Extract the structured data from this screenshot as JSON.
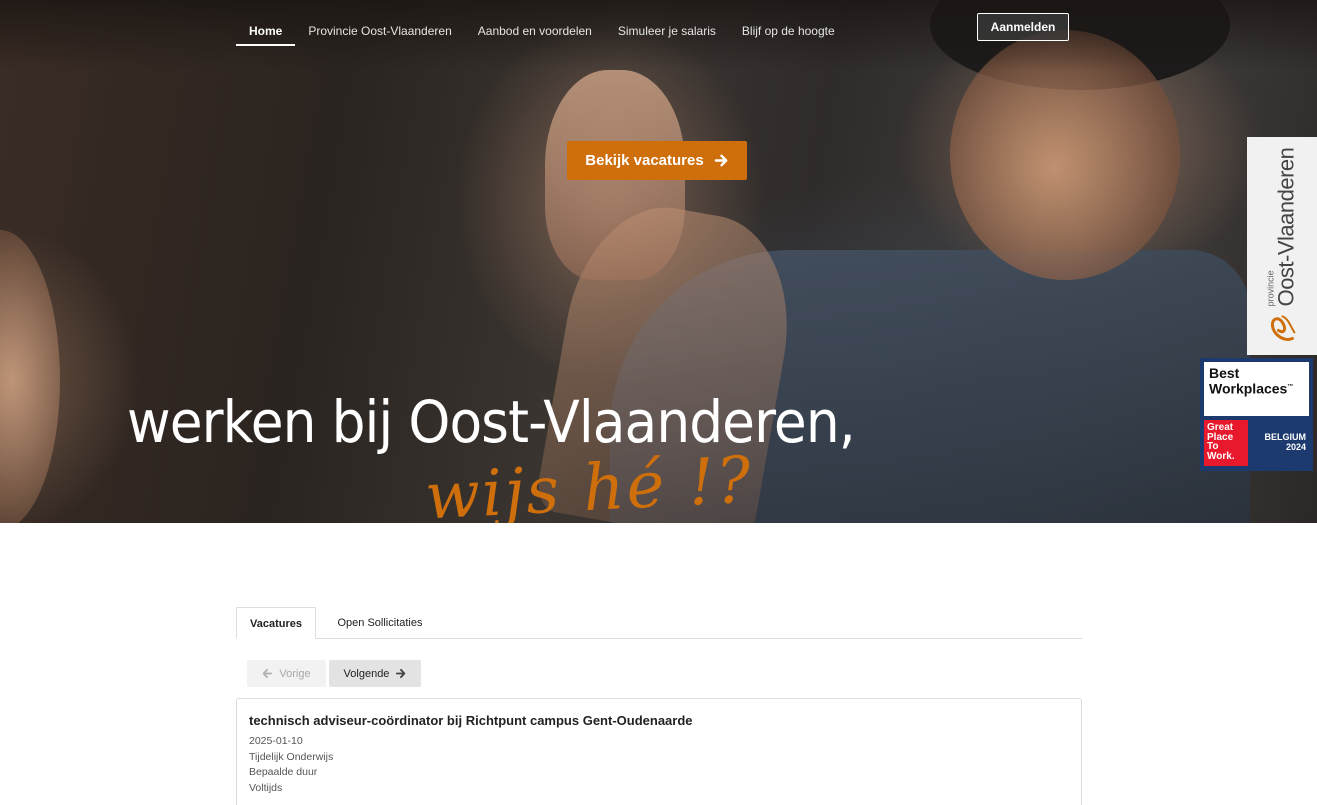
{
  "nav": {
    "items": [
      {
        "label": "Home",
        "active": true
      },
      {
        "label": "Provincie Oost-Vlaanderen",
        "active": false
      },
      {
        "label": "Aanbod en voordelen",
        "active": false
      },
      {
        "label": "Simuleer je salaris",
        "active": false
      },
      {
        "label": "Blijf op de hoogte",
        "active": false
      }
    ],
    "login_label": "Aanmelden"
  },
  "hero": {
    "cta_label": "Bekijk vacatures",
    "cta_icon": "arrow-right-icon",
    "headline": "werken bij Oost-Vlaanderen,",
    "tagline": "wijs hé !?",
    "accent_color": "#cf6f0c"
  },
  "side_logo": {
    "small": "provincie",
    "name": "Oost-Vlaanderen"
  },
  "award": {
    "line1": "Best",
    "line2": "Workplaces",
    "tm": "™",
    "gp1": "Great",
    "gp2": "Place",
    "gp3": "To",
    "gp4": "Work.",
    "country": "BELGIUM",
    "year": "2024"
  },
  "tabs": [
    {
      "label": "Vacatures",
      "active": true
    },
    {
      "label": "Open Sollicitaties",
      "active": false
    }
  ],
  "pager": {
    "prev_label": "Vorige",
    "next_label": "Volgende"
  },
  "jobs": [
    {
      "title": "technisch adviseur-coördinator bij Richtpunt campus Gent-Oudenaarde",
      "date": "2025-01-10",
      "type": "Tijdelijk Onderwijs",
      "duration": "Bepaalde duur",
      "regime": "Voltijds"
    }
  ]
}
